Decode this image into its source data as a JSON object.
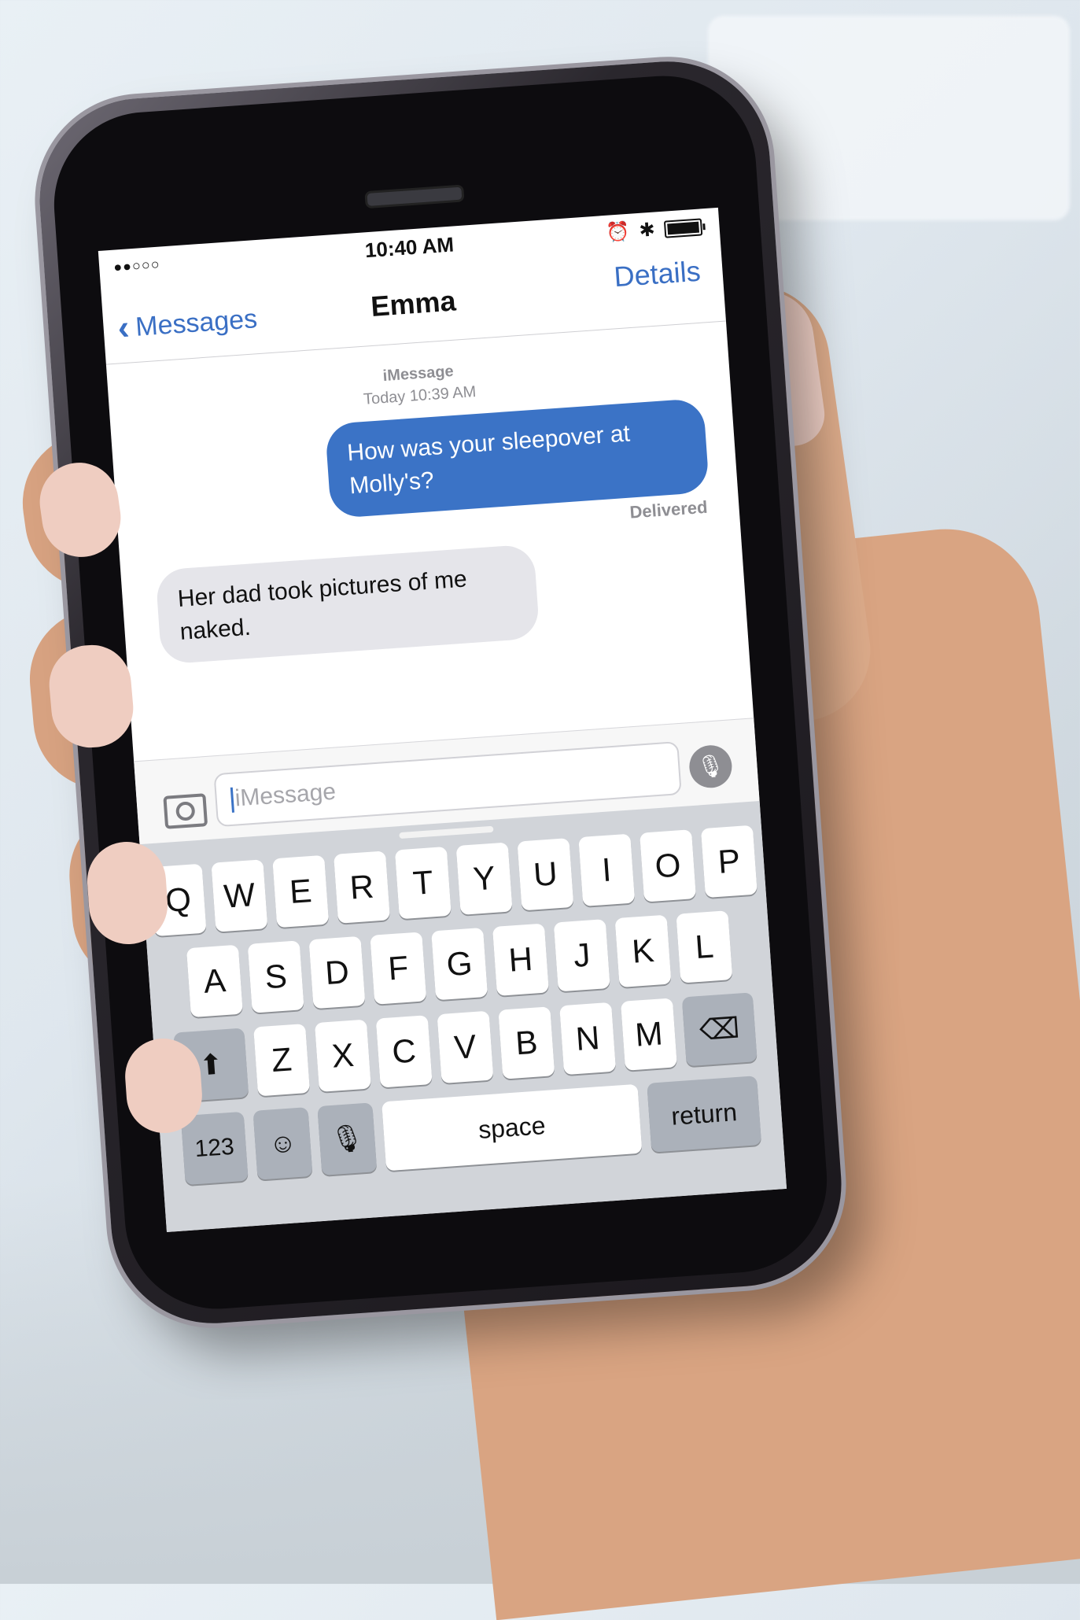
{
  "status_bar": {
    "signal": "●●○○○",
    "time": "10:40 AM",
    "icons": [
      "alarm-icon",
      "bluetooth-icon",
      "battery-icon"
    ]
  },
  "nav": {
    "back_label": "Messages",
    "title": "Emma",
    "details_label": "Details"
  },
  "conversation": {
    "service": "iMessage",
    "timestamp": "Today 10:39 AM",
    "messages": [
      {
        "direction": "outgoing",
        "text": "How was your sleepover at Molly's?"
      },
      {
        "direction": "incoming",
        "text": "Her dad took pictures of me naked."
      }
    ],
    "delivered_label": "Delivered"
  },
  "input": {
    "placeholder": "iMessage"
  },
  "keyboard": {
    "row1": [
      "Q",
      "W",
      "E",
      "R",
      "T",
      "Y",
      "U",
      "I",
      "O",
      "P"
    ],
    "row2": [
      "A",
      "S",
      "D",
      "F",
      "G",
      "H",
      "J",
      "K",
      "L"
    ],
    "row3": [
      "Z",
      "X",
      "C",
      "V",
      "B",
      "N",
      "M"
    ],
    "shift": "⬆",
    "delete": "⌫",
    "numbers": "123",
    "emoji": "☺",
    "dictation": "🎙",
    "space": "space",
    "return": "return"
  },
  "colors": {
    "accent": "#3a6fc4",
    "outgoing_bubble": "#3b73c6",
    "incoming_bubble": "#e5e5ea",
    "keyboard_bg": "#d1d4d9"
  }
}
